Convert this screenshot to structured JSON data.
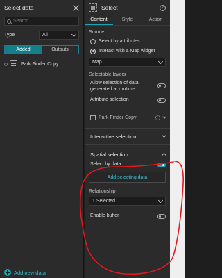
{
  "left_panel": {
    "title": "Select data",
    "search_placeholder": "Search",
    "type_label": "Type",
    "type_value": "All",
    "tabs": [
      {
        "label": "Added"
      },
      {
        "label": "Outputs"
      }
    ],
    "items": [
      {
        "label": "Park Finder Copy"
      }
    ],
    "add_new_data": "Add new data"
  },
  "right_panel": {
    "title": "Select",
    "help": "?",
    "tabs": [
      {
        "label": "Content"
      },
      {
        "label": "Style"
      },
      {
        "label": "Action"
      }
    ],
    "source_label": "Source",
    "radio_attributes": "Select by attributes",
    "radio_map": "Interact with a Map widget",
    "map_select_value": "Map",
    "selectable_layers_label": "Selectable layers",
    "allow_runtime": "Allow selection of data generated at runtime",
    "attribute_selection": "Attribute selection",
    "layer_name": "Park Finder Copy",
    "interactive_selection": "Interactive selection",
    "spatial_selection": "Spatial selection",
    "select_by_data": "Select by data",
    "add_selecting_data": "Add selecting data",
    "relationship_label": "Relationship",
    "relationship_value": "1 Selected",
    "enable_buffer": "Enable buffer"
  },
  "colors": {
    "accent": "#1aa3b5",
    "annotation": "#e0191f"
  }
}
